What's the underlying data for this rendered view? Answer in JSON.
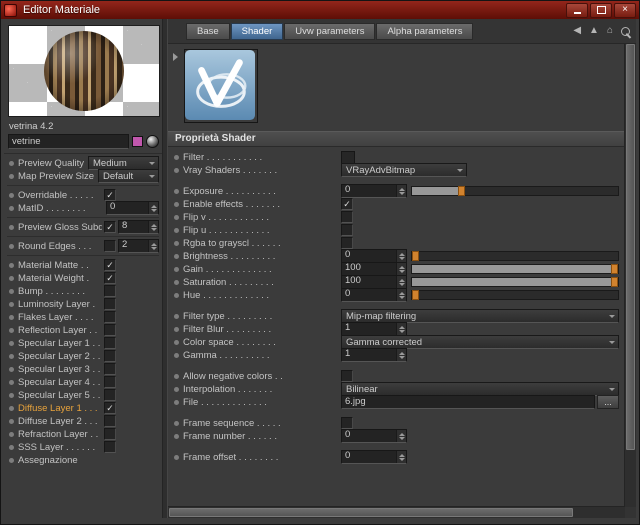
{
  "window": {
    "title": "Editor Materiale"
  },
  "titlebar_controls": {
    "close_glyph": "×"
  },
  "tabs": [
    {
      "label": "Base",
      "active": false
    },
    {
      "label": "Shader",
      "active": true
    },
    {
      "label": "Uvw parameters",
      "active": false
    },
    {
      "label": "Alpha parameters",
      "active": false
    }
  ],
  "header_icons": [
    {
      "name": "nav-back-icon",
      "glyph": "◀"
    },
    {
      "name": "arrow-up-icon",
      "glyph": "▲"
    },
    {
      "name": "home-icon",
      "glyph": "⌂"
    },
    {
      "name": "pin-icon",
      "glyph": ""
    }
  ],
  "left_panel": {
    "material_title": "vetrina 4.2",
    "name_value": "vetrine",
    "swatch_color": "#c157ad",
    "rows": [
      {
        "type": "dropdown",
        "label": "Preview Quality",
        "value": "Medium"
      },
      {
        "type": "dropdown",
        "label": "Map Preview Size",
        "value": "Default"
      },
      {
        "type": "sep"
      },
      {
        "type": "checkbox",
        "label": "Overridable . . . . .",
        "checked": true
      },
      {
        "type": "spinner",
        "label": "MatID . . . . . . . .",
        "value": "0"
      },
      {
        "type": "sep"
      },
      {
        "type": "checkspin",
        "label": "Preview Gloss Subdivs",
        "checked": true,
        "value": "8"
      },
      {
        "type": "sep"
      },
      {
        "type": "checkspin",
        "label": "Round Edges . . .",
        "checked": false,
        "value": "2"
      },
      {
        "type": "sep"
      },
      {
        "type": "checkbox",
        "label": "Material Matte . .",
        "checked": true
      },
      {
        "type": "checkbox",
        "label": "Material Weight .",
        "checked": true
      },
      {
        "type": "checkbox",
        "label": "Bump . . . . . . . .",
        "checked": false
      },
      {
        "type": "checkbox",
        "label": "Luminosity Layer .",
        "checked": false
      },
      {
        "type": "checkbox",
        "label": "Flakes Layer . . . .",
        "checked": false
      },
      {
        "type": "checkbox",
        "label": "Reflection Layer . .",
        "checked": false
      },
      {
        "type": "checkbox",
        "label": "Specular Layer 1 . .",
        "checked": false
      },
      {
        "type": "checkbox",
        "label": "Specular Layer 2 . .",
        "checked": false
      },
      {
        "type": "checkbox",
        "label": "Specular Layer 3 . .",
        "checked": false
      },
      {
        "type": "checkbox",
        "label": "Specular Layer 4 . .",
        "checked": false
      },
      {
        "type": "checkbox",
        "label": "Specular Layer 5 . .",
        "checked": false
      },
      {
        "type": "checkbox",
        "label": "Diffuse Layer 1 . . .",
        "checked": true,
        "highlight": true
      },
      {
        "type": "checkbox",
        "label": "Diffuse Layer 2 . . .",
        "checked": false
      },
      {
        "type": "checkbox",
        "label": "Refraction Layer . .",
        "checked": false
      },
      {
        "type": "checkbox",
        "label": "SSS Layer . . . . . .",
        "checked": false
      },
      {
        "type": "label",
        "label": "Assegnazione"
      }
    ]
  },
  "shader_panel": {
    "section_header": "Proprietà Shader",
    "params": [
      {
        "type": "minibox",
        "label": "Filter . . . . . . . . . . ."
      },
      {
        "type": "dropdown",
        "label": "Vray Shaders . . . . . . .",
        "value": "VRayAdvBitmap",
        "width": "short"
      },
      {
        "type": "gap"
      },
      {
        "type": "spinslider",
        "label": "Exposure . . . . . . . . . .",
        "value": "0",
        "fill": 23,
        "thumb": 23
      },
      {
        "type": "checkbox",
        "label": "Enable effects . . . . . . .",
        "checked": true
      },
      {
        "type": "checkbox",
        "label": "Flip v . . . . . . . . . . . .",
        "checked": false
      },
      {
        "type": "checkbox",
        "label": "Flip u . . . . . . . . . . . .",
        "checked": false
      },
      {
        "type": "checkbox",
        "label": "Rgba to grayscl . . . . . .",
        "checked": false
      },
      {
        "type": "spinslider",
        "label": "Brightness . . . . . . . . .",
        "value": "0",
        "fill": 0,
        "thumb": 0
      },
      {
        "type": "spinslider",
        "label": "Gain . . . . . . . . . . . . .",
        "value": "100",
        "fill": 100,
        "thumb": 100
      },
      {
        "type": "spinslider",
        "label": "Saturation . . . . . . . . .",
        "value": "100",
        "fill": 100,
        "thumb": 100
      },
      {
        "type": "spinslider",
        "label": "Hue . . . . . . . . . . . . .",
        "value": "0",
        "fill": 0,
        "thumb": 0
      },
      {
        "type": "gap"
      },
      {
        "type": "dropdown",
        "label": "Filter type . . . . . . . . .",
        "value": "Mip-map filtering",
        "width": "full"
      },
      {
        "type": "spinner",
        "label": "Filter Blur . . . . . . . . .",
        "value": "1"
      },
      {
        "type": "dropdown",
        "label": "Color space . . . . . . . .",
        "value": "Gamma corrected",
        "width": "full"
      },
      {
        "type": "spinner",
        "label": "Gamma . . . . . . . . . .",
        "value": "1"
      },
      {
        "type": "gap"
      },
      {
        "type": "checkbox",
        "label": "Allow negative colors . .",
        "checked": false
      },
      {
        "type": "dropdown",
        "label": "Interpolation . . . . . . .",
        "value": "Bilinear",
        "width": "full"
      },
      {
        "type": "file",
        "label": "File . . . . . . . . . . . . .",
        "value": "6.jpg",
        "browse": "..."
      },
      {
        "type": "gap"
      },
      {
        "type": "checkbox",
        "label": "Frame sequence . . . . .",
        "checked": false
      },
      {
        "type": "spinner",
        "label": "Frame number . . . . . .",
        "value": "0"
      },
      {
        "type": "gap"
      },
      {
        "type": "spinner",
        "label": "Frame offset . . . . . . . .",
        "value": "0"
      }
    ]
  },
  "colors": {
    "accent_blue": "#4d7ba9",
    "accent_orange": "#e09a3c",
    "titlebar": "#7a1812"
  }
}
